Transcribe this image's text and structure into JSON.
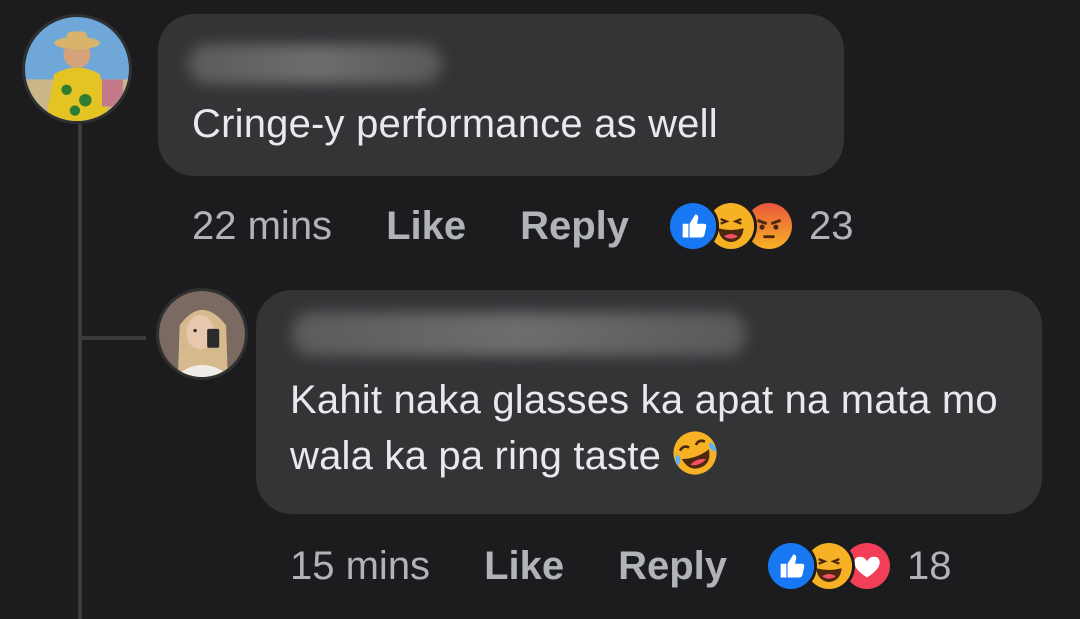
{
  "comments": [
    {
      "text": "Cringe-y performance as well",
      "time": "22 mins",
      "like_label": "Like",
      "reply_label": "Reply",
      "reaction_icons": [
        "like-icon",
        "haha-icon",
        "angry-icon"
      ],
      "reaction_count": "23"
    },
    {
      "text": "Kahit naka glasses ka apat na mata mo wala ka pa ring taste",
      "text_emoji": "rofl-emoji",
      "time": "15 mins",
      "like_label": "Like",
      "reply_label": "Reply",
      "reaction_icons": [
        "like-icon",
        "haha-icon",
        "love-icon"
      ],
      "reaction_count": "18"
    }
  ],
  "colors": {
    "background": "#1c1c1e",
    "bubble": "#333436",
    "meta_text": "#b0b3b8",
    "like_blue": "#1877f2",
    "love_red": "#f33e58",
    "emoji_yellow": "#f7b125"
  }
}
